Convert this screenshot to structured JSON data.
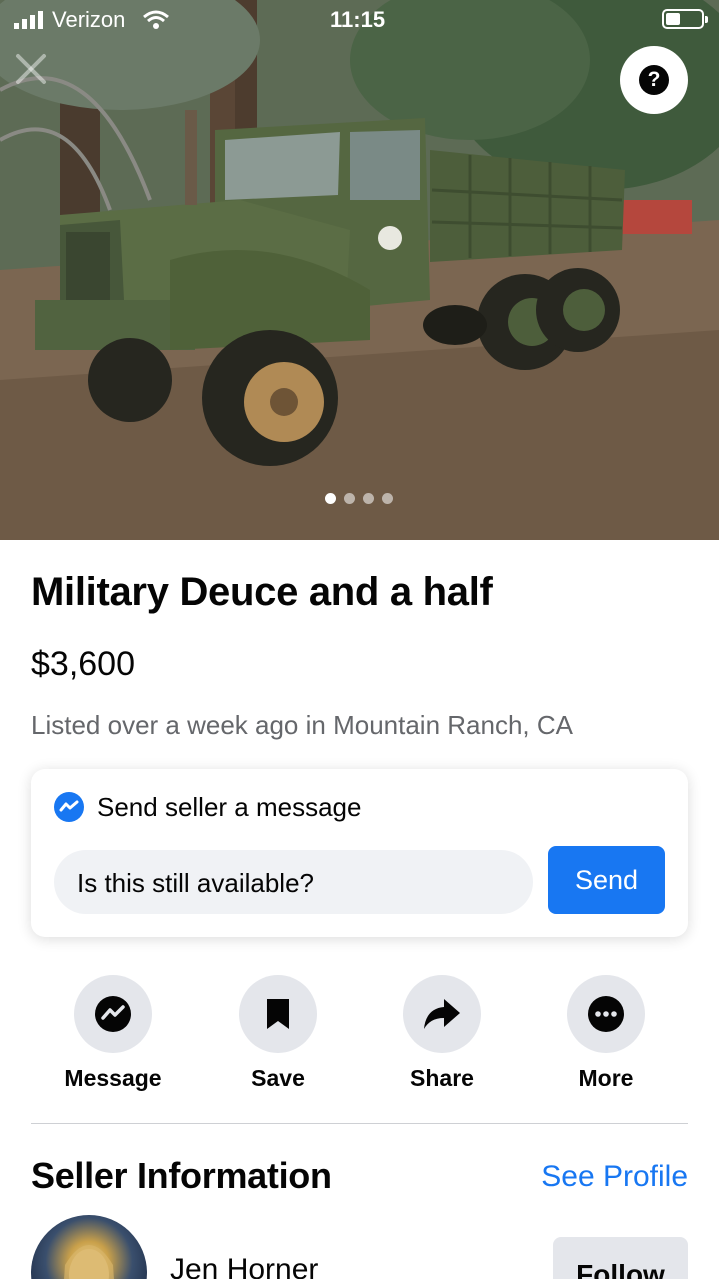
{
  "status_bar": {
    "carrier": "Verizon",
    "time": "11:15",
    "icons": [
      "signal-icon",
      "wifi-icon",
      "battery-icon"
    ]
  },
  "hero": {
    "photo_subject": "green military truck parked on pine-needle ground",
    "photo_count": 4,
    "active_photo": 1,
    "help_symbol": "?",
    "icons": [
      "close-icon",
      "help-icon"
    ]
  },
  "listing": {
    "title": "Military Deuce and a half",
    "price": "$3,600",
    "meta": "Listed over a week ago in Mountain Ranch, CA"
  },
  "message_card": {
    "heading": "Send seller a message",
    "input_value": "Is this still available?",
    "send_label": "Send",
    "icon": "messenger-icon"
  },
  "actions": [
    {
      "label": "Message",
      "icon": "messenger-icon"
    },
    {
      "label": "Save",
      "icon": "bookmark-icon"
    },
    {
      "label": "Share",
      "icon": "share-arrow-icon"
    },
    {
      "label": "More",
      "icon": "more-dots-icon"
    }
  ],
  "seller": {
    "heading": "Seller Information",
    "see_profile": "See Profile",
    "name": "Jen Horner",
    "follow_label": "Follow"
  },
  "colors": {
    "accent": "#1877f2",
    "secondary_text": "#65676b",
    "button_gray": "#e4e6eb",
    "input_bg": "#f0f2f5"
  }
}
